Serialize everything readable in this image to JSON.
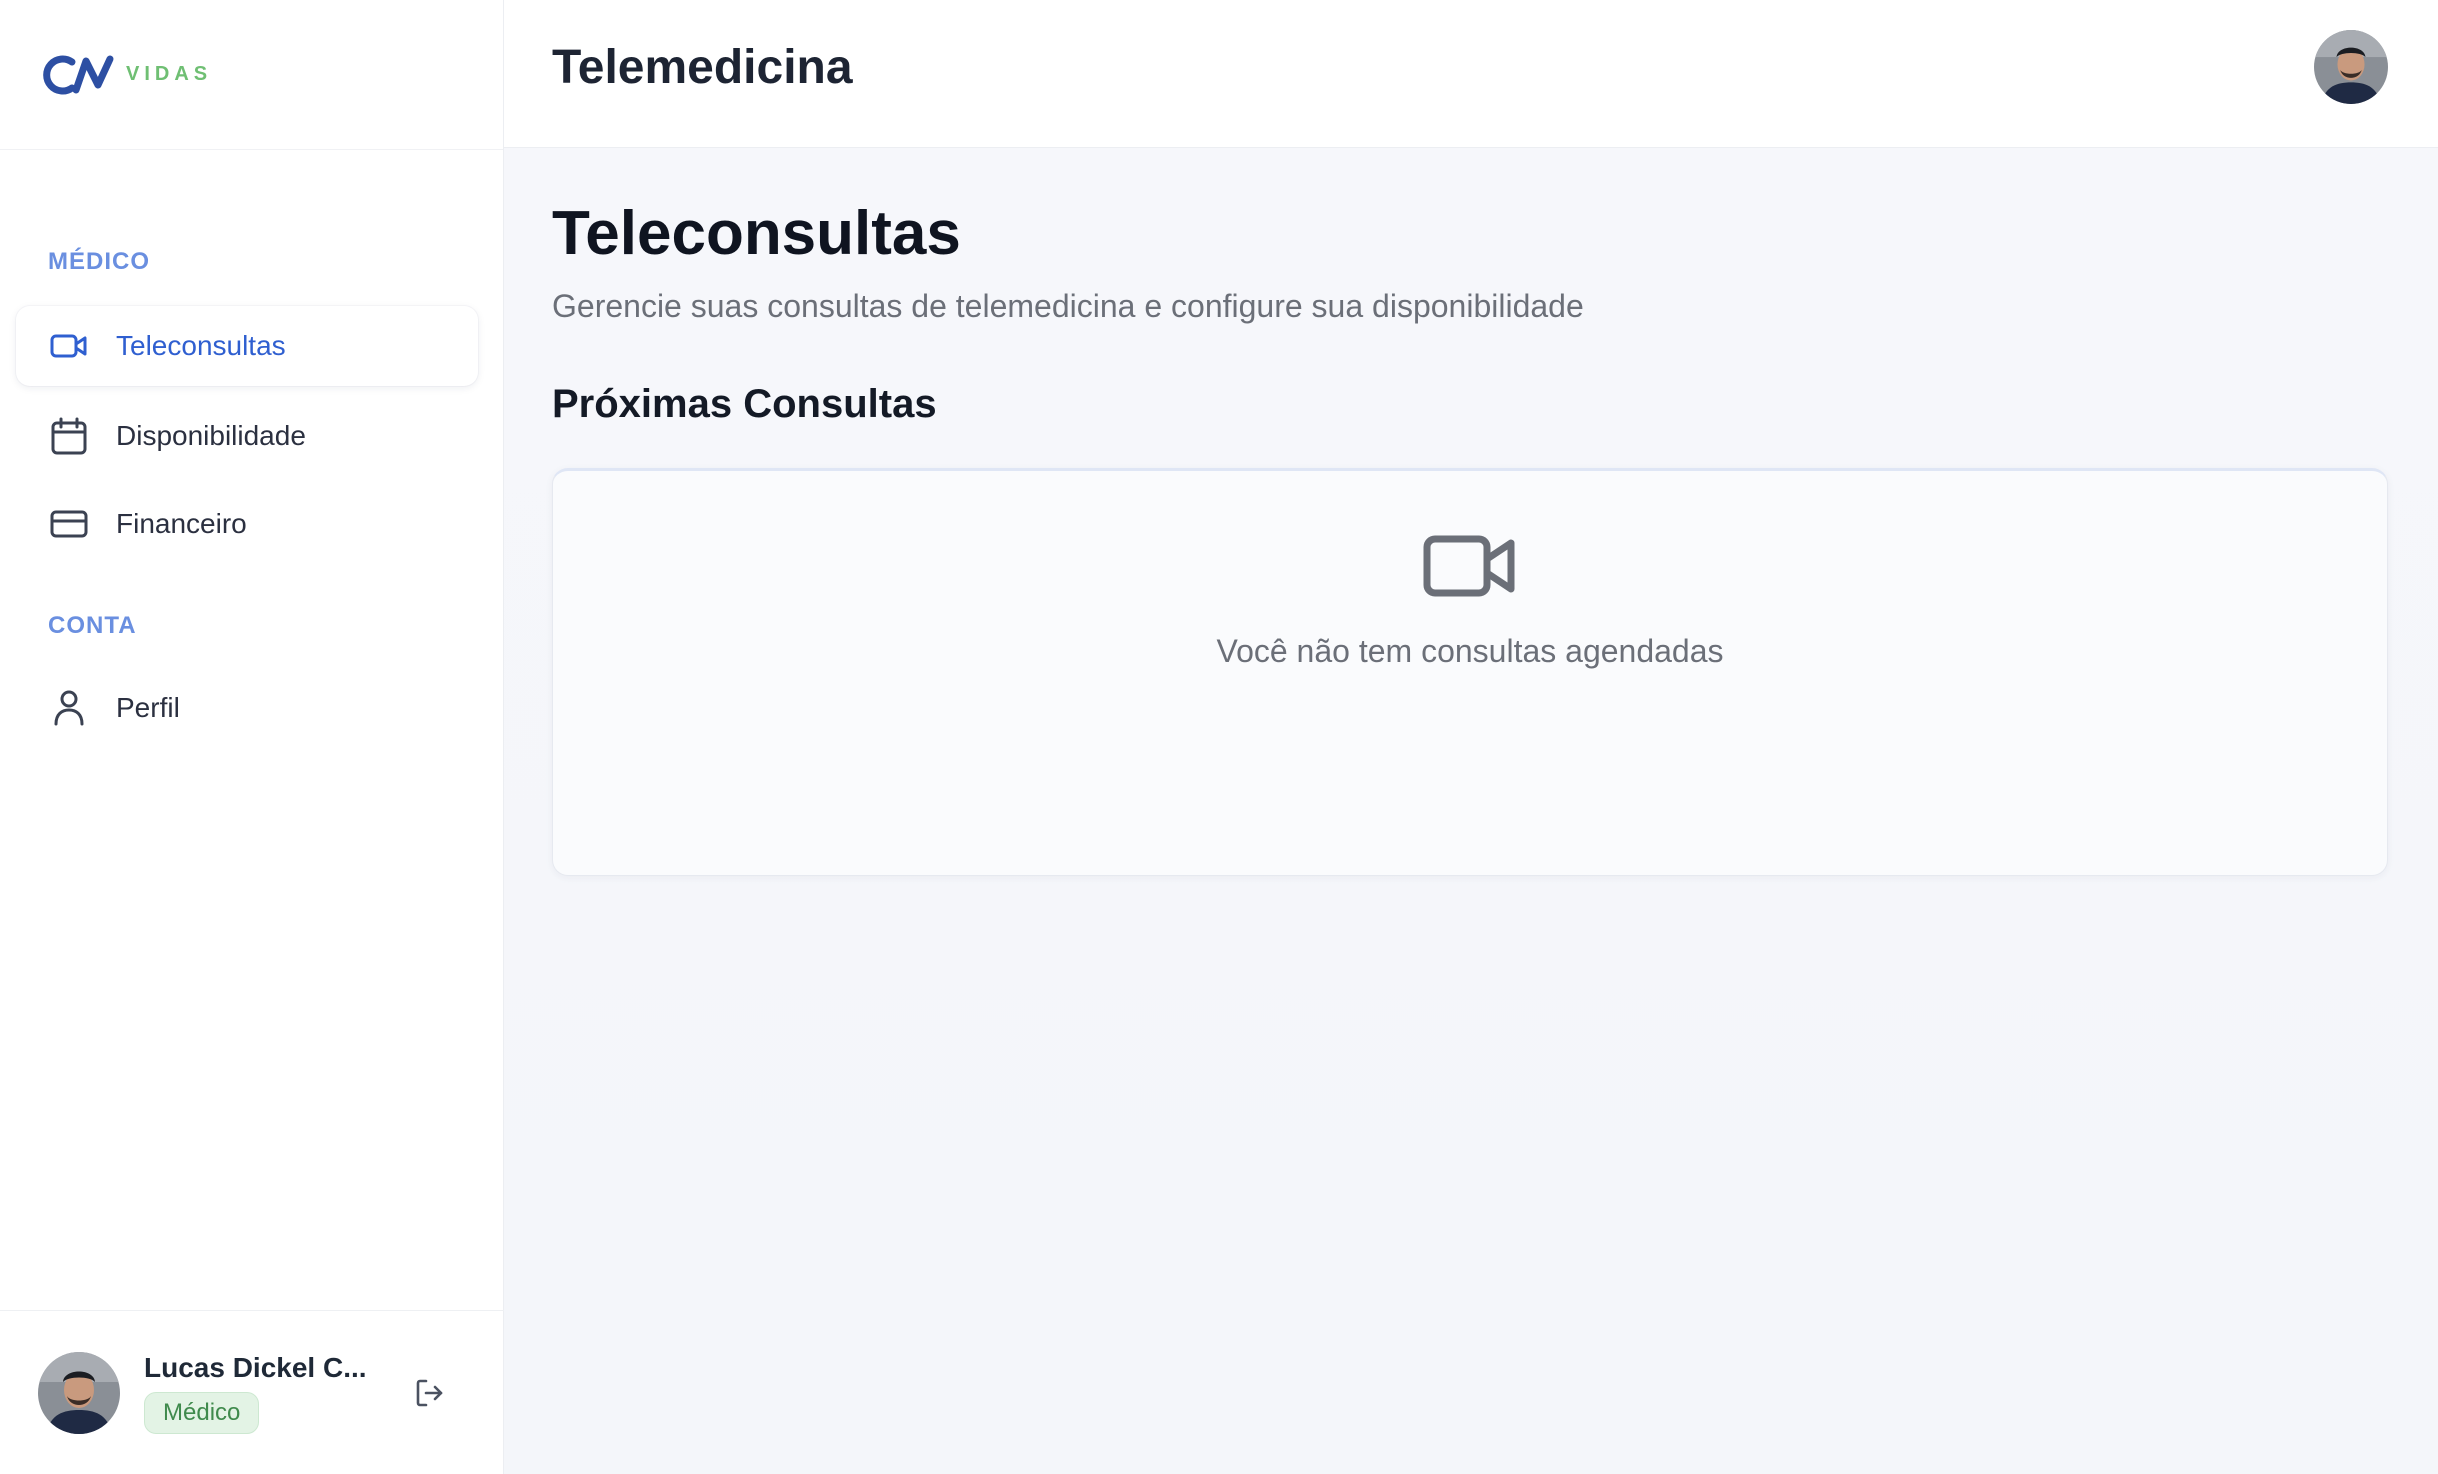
{
  "brand": {
    "logo_mark": "CN",
    "logo_word": "VIDAS",
    "accent": "#2f5fd0",
    "secondary": "#6fbf73"
  },
  "header": {
    "title": "Telemedicina",
    "avatar_icon": "user-avatar"
  },
  "sidebar": {
    "sections": [
      {
        "label": "MÉDICO",
        "items": [
          {
            "label": "Teleconsultas",
            "icon": "video-icon",
            "active": true
          },
          {
            "label": "Disponibilidade",
            "icon": "calendar-icon",
            "active": false
          },
          {
            "label": "Financeiro",
            "icon": "credit-card-icon",
            "active": false
          }
        ]
      },
      {
        "label": "CONTA",
        "items": [
          {
            "label": "Perfil",
            "icon": "user-icon",
            "active": false
          }
        ]
      }
    ],
    "user": {
      "name": "Lucas Dickel C...",
      "role": "Médico",
      "logout_icon": "logout-icon"
    }
  },
  "main": {
    "title": "Teleconsultas",
    "subtitle": "Gerencie suas consultas de telemedicina e configure sua disponibilidade",
    "section_title": "Próximas Consultas",
    "empty_state": {
      "icon": "video-icon",
      "text": "Você não tem consultas agendadas"
    }
  }
}
